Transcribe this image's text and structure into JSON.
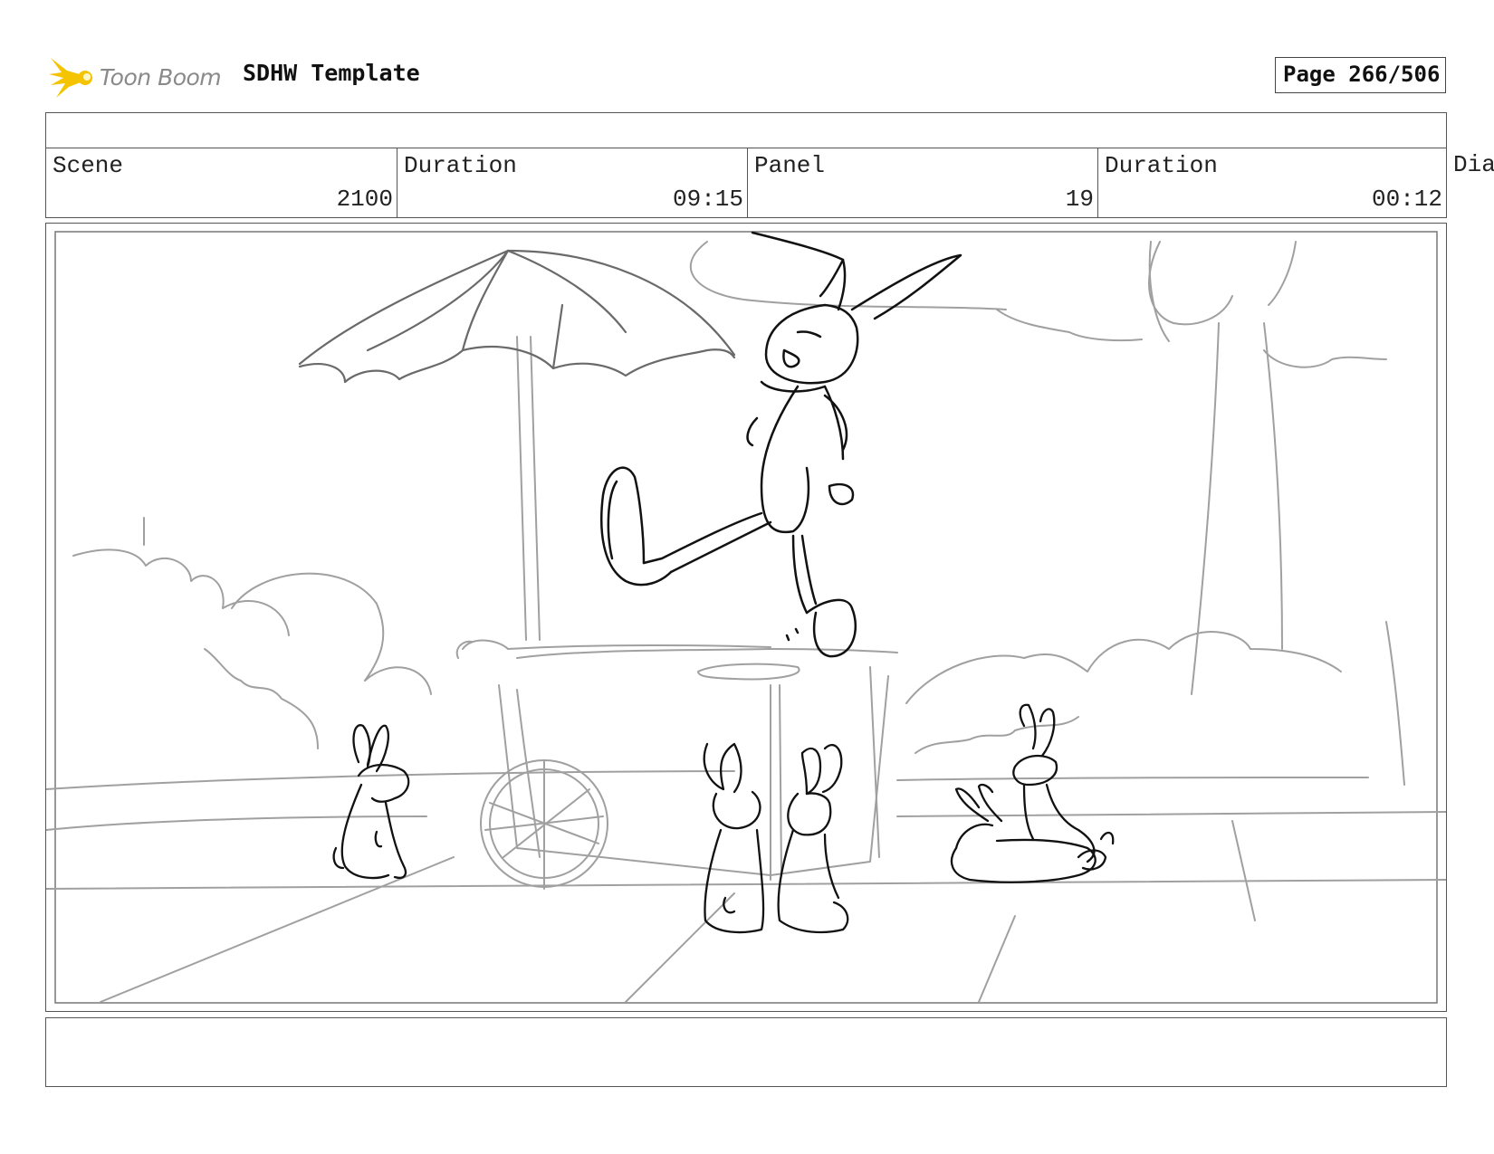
{
  "header": {
    "logo_text": "Toon Boom",
    "template_title": "SDHW Template",
    "page_label": "Page 266/506"
  },
  "info": {
    "scene_label": "Scene",
    "scene_value": "2100",
    "scene_duration_label": "Duration",
    "scene_duration_value": "09:15",
    "panel_label": "Panel",
    "panel_value": "19",
    "panel_duration_label": "Duration",
    "panel_duration_value": "00:12",
    "dialog_label_partial": "Dia"
  },
  "colors": {
    "logo_yellow": "#f5c400",
    "border": "#555555",
    "sketch_dark": "#111111",
    "sketch_light": "#9a9a9a"
  }
}
